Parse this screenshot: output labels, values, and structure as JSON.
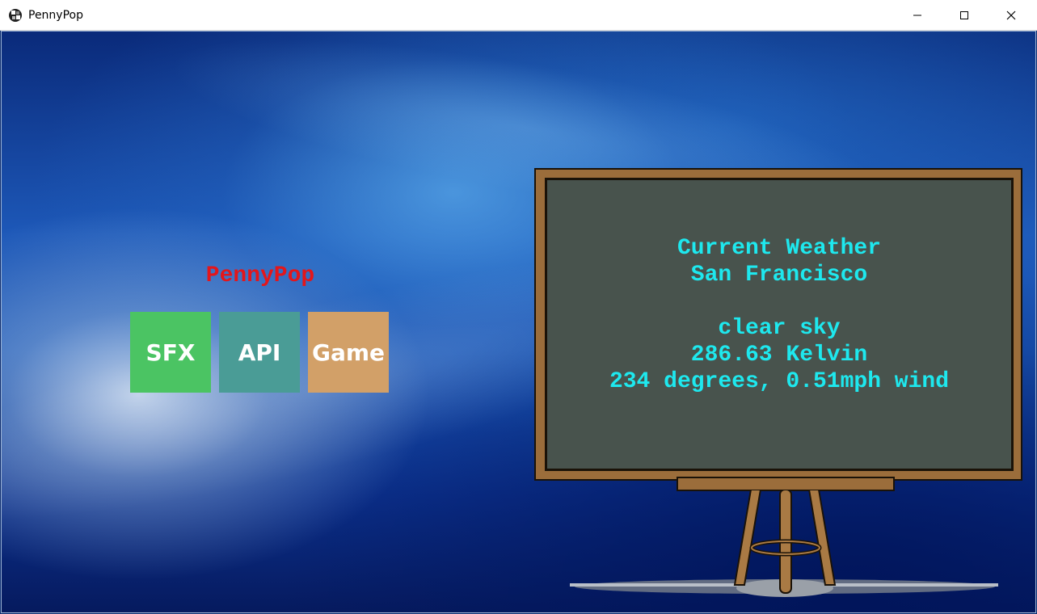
{
  "window": {
    "title": "PennyPop",
    "controls": {
      "minimize": "minimize-icon",
      "maximize": "maximize-icon",
      "close": "close-icon"
    }
  },
  "brand": {
    "name": "PennyPop",
    "color": "#e3161b"
  },
  "tiles": [
    {
      "label": "SFX",
      "color": "#4bc463"
    },
    {
      "label": "API",
      "color": "#4a9c96"
    },
    {
      "label": "Game",
      "color": "#d2a068"
    }
  ],
  "weather": {
    "heading": "Current Weather",
    "city": "San Francisco",
    "condition": "clear sky",
    "temperature": "286.63 Kelvin",
    "wind": "234 degrees, 0.51mph wind",
    "text_color": "#1ee8ee",
    "board_color": "#48534d",
    "frame_color": "#9b6d3b"
  }
}
